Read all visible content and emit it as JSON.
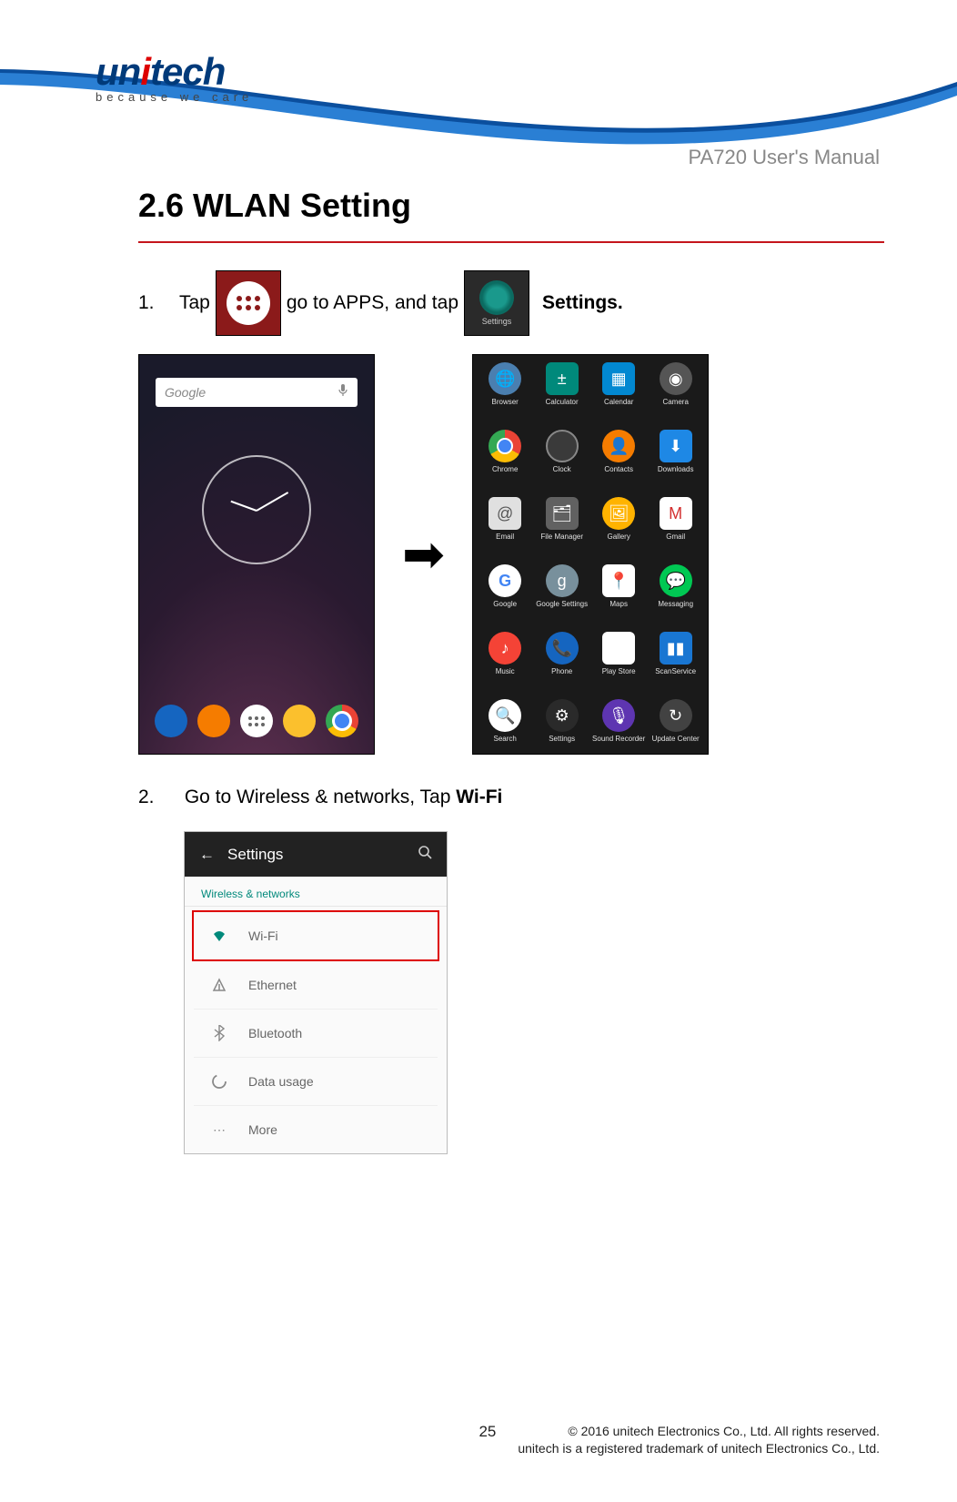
{
  "logo": {
    "brand": "unitech",
    "tagline": "because we care"
  },
  "doc_title": "PA720 User's Manual",
  "section": {
    "heading": "2.6 WLAN Setting"
  },
  "step1": {
    "num": "1.",
    "pre": "Tap ",
    "mid": " go to APPS, and tap ",
    "post_bold": "Settings.",
    "settings_icon_label": "Settings"
  },
  "home": {
    "search_placeholder": "Google"
  },
  "apps": [
    "Browser",
    "Calculator",
    "Calendar",
    "Camera",
    "Chrome",
    "Clock",
    "Contacts",
    "Downloads",
    "Email",
    "File Manager",
    "Gallery",
    "Gmail",
    "Google",
    "Google Settings",
    "Maps",
    "Messaging",
    "Music",
    "Phone",
    "Play Store",
    "ScanService",
    "Search",
    "Settings",
    "Sound Recorder",
    "Update Center"
  ],
  "step2": {
    "num": "2.",
    "text": "Go to Wireless & networks, Tap ",
    "bold": "Wi-Fi"
  },
  "settings_shot": {
    "title": "Settings",
    "section": "Wireless & networks",
    "rows": {
      "wifi": "Wi-Fi",
      "ethernet": "Ethernet",
      "bluetooth": "Bluetooth",
      "data_usage": "Data usage",
      "more": "More"
    }
  },
  "footer": {
    "page": "25",
    "copy1": "© 2016 unitech Electronics Co., Ltd. All rights reserved.",
    "copy2": "unitech is a registered trademark of unitech Electronics Co., Ltd."
  }
}
